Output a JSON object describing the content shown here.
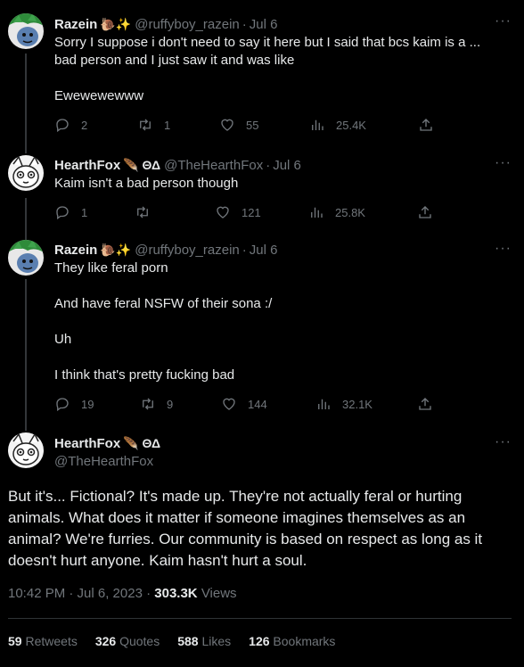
{
  "tweets": [
    {
      "name": "Razein",
      "emojis": "🐌✨",
      "handle": "@ruffyboy_razein",
      "date": "Jul 6",
      "lines": [
        "Sorry I suppose i don't need to say it here but I said that bcs kaim is a ...",
        "bad person and I just saw it and was like",
        "Ewewewewww"
      ],
      "replies": "2",
      "retweets": "1",
      "likes": "55",
      "views": "25.4K"
    },
    {
      "name": "HearthFox",
      "emojis": "🪶 ΘΔ",
      "handle": "@TheHearthFox",
      "date": "Jul 6",
      "lines": [
        "Kaim isn't a bad person though"
      ],
      "replies": "1",
      "retweets": "",
      "likes": "121",
      "views": "25.8K"
    },
    {
      "name": "Razein",
      "emojis": "🐌✨",
      "handle": "@ruffyboy_razein",
      "date": "Jul 6",
      "lines": [
        "They like feral porn",
        "And have feral NSFW of their sona :/",
        "Uh",
        "I think that's pretty fucking bad"
      ],
      "replies": "19",
      "retweets": "9",
      "likes": "144",
      "views": "32.1K"
    }
  ],
  "main_tweet": {
    "name": "HearthFox",
    "emojis": "🪶 ΘΔ",
    "handle": "@TheHearthFox",
    "text": "But it's... Fictional? It's made up. They're not actually feral or hurting animals. What does it matter if someone imagines themselves as an animal? We're furries. Our community is based on respect as long as it doesn't hurt anyone. Kaim hasn't hurt a soul.",
    "time": "10:42 PM · Jul 6, 2023 ·",
    "views_count": "303.3K",
    "views_label": "Views",
    "retweets": "59",
    "retweets_label": "Retweets",
    "quotes": "326",
    "quotes_label": "Quotes",
    "likes": "588",
    "likes_label": "Likes",
    "bookmarks": "126",
    "bookmarks_label": "Bookmarks"
  },
  "more_glyph": "···",
  "dot": "·",
  "icons": {
    "reply": "reply-icon",
    "retweet": "retweet-icon",
    "like": "heart-icon",
    "views": "views-icon",
    "share": "share-icon"
  },
  "colors": {
    "background": "#000000",
    "text": "#e7e9ea",
    "muted": "#71767b",
    "thread_line": "#333639"
  }
}
